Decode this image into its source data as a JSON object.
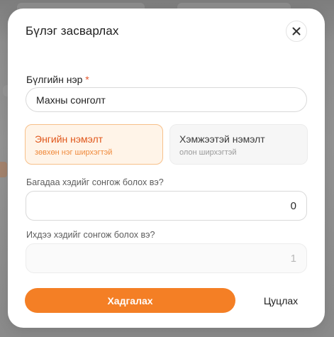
{
  "modal": {
    "title": "Бүлэг засварлах",
    "close_icon": "close-icon"
  },
  "group_name": {
    "label": "Бүлгийн нэр",
    "required_mark": "*",
    "value": "Махны сонголт"
  },
  "type_options": [
    {
      "title": "Энгийн нэмэлт",
      "subtitle": "зөвхөн нэг ширхэгтэй",
      "selected": true
    },
    {
      "title": "Хэмжээтэй нэмэлт",
      "subtitle": "олон ширхэгтэй",
      "selected": false
    }
  ],
  "min_select": {
    "label": "Багадаа хэдийг сонгож болох вэ?",
    "value": "0"
  },
  "max_select": {
    "label": "Ихдээ хэдийг сонгож болох вэ?",
    "value": "1",
    "disabled": true
  },
  "actions": {
    "save_label": "Хадгалах",
    "cancel_label": "Цуцлах"
  },
  "colors": {
    "accent": "#f47f25",
    "selected_card_bg": "#fff4e8",
    "selected_card_border": "#f7c08a",
    "required": "#e4572e"
  }
}
